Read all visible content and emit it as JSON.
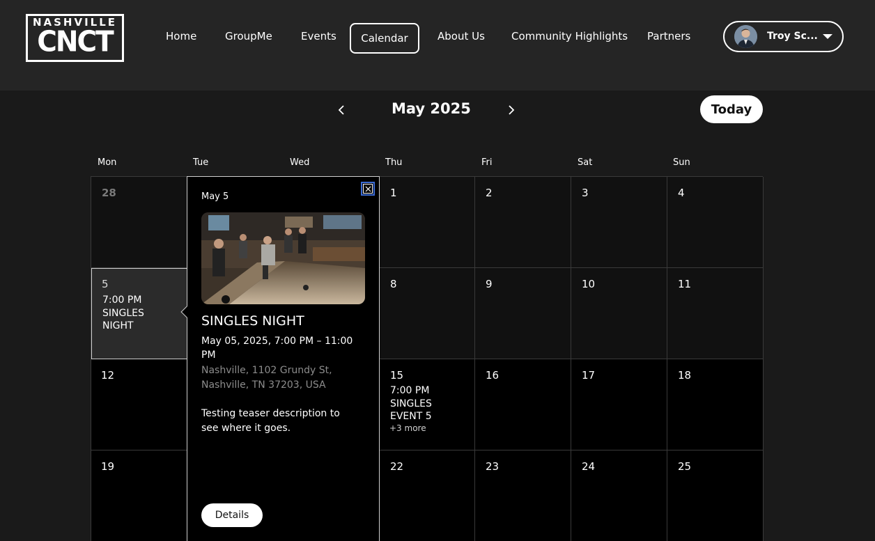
{
  "brand": {
    "top": "NASHVILLE",
    "main": "CNCT"
  },
  "nav": {
    "home": "Home",
    "groupme": "GroupMe",
    "events": "Events",
    "calendar": "Calendar",
    "about": "About Us",
    "community": "Community Highlights",
    "partners": "Partners"
  },
  "user": {
    "name": "Troy Sc..."
  },
  "calendar": {
    "month": "May 2025",
    "today": "Today",
    "days": [
      "Mon",
      "Tue",
      "Wed",
      "Thu",
      "Fri",
      "Sat",
      "Sun"
    ],
    "weeks": [
      [
        "28",
        "",
        "",
        "1",
        "2",
        "3",
        "4"
      ],
      [
        "5",
        "",
        "",
        "8",
        "9",
        "10",
        "11"
      ],
      [
        "12",
        "",
        "",
        "15",
        "16",
        "17",
        "18"
      ],
      [
        "19",
        "",
        "",
        "22",
        "23",
        "24",
        "25"
      ]
    ],
    "cell_may5": {
      "time": "7:00 PM",
      "title_1": "SINGLES",
      "title_2": "NIGHT"
    },
    "cell_may15": {
      "time": "7:00 PM",
      "title_1": "SINGLES",
      "title_2": "EVENT 5",
      "more": "+3 more"
    }
  },
  "popup": {
    "date": "May 5",
    "title": "SINGLES NIGHT",
    "when_1": "May 05, 2025, 7:00 PM – 11:00",
    "when_2": "PM",
    "where_1": "Nashville, 1102 Grundy St,",
    "where_2": "Nashville, TN 37203, USA",
    "desc_1": "Testing teaser description to",
    "desc_2": "see where it goes.",
    "details": "Details",
    "close_icon": "close-icon"
  },
  "colors": {
    "header_bg": "#252525",
    "main_bg": "#1a1a1a",
    "accent_focus": "#3b6bd4"
  }
}
